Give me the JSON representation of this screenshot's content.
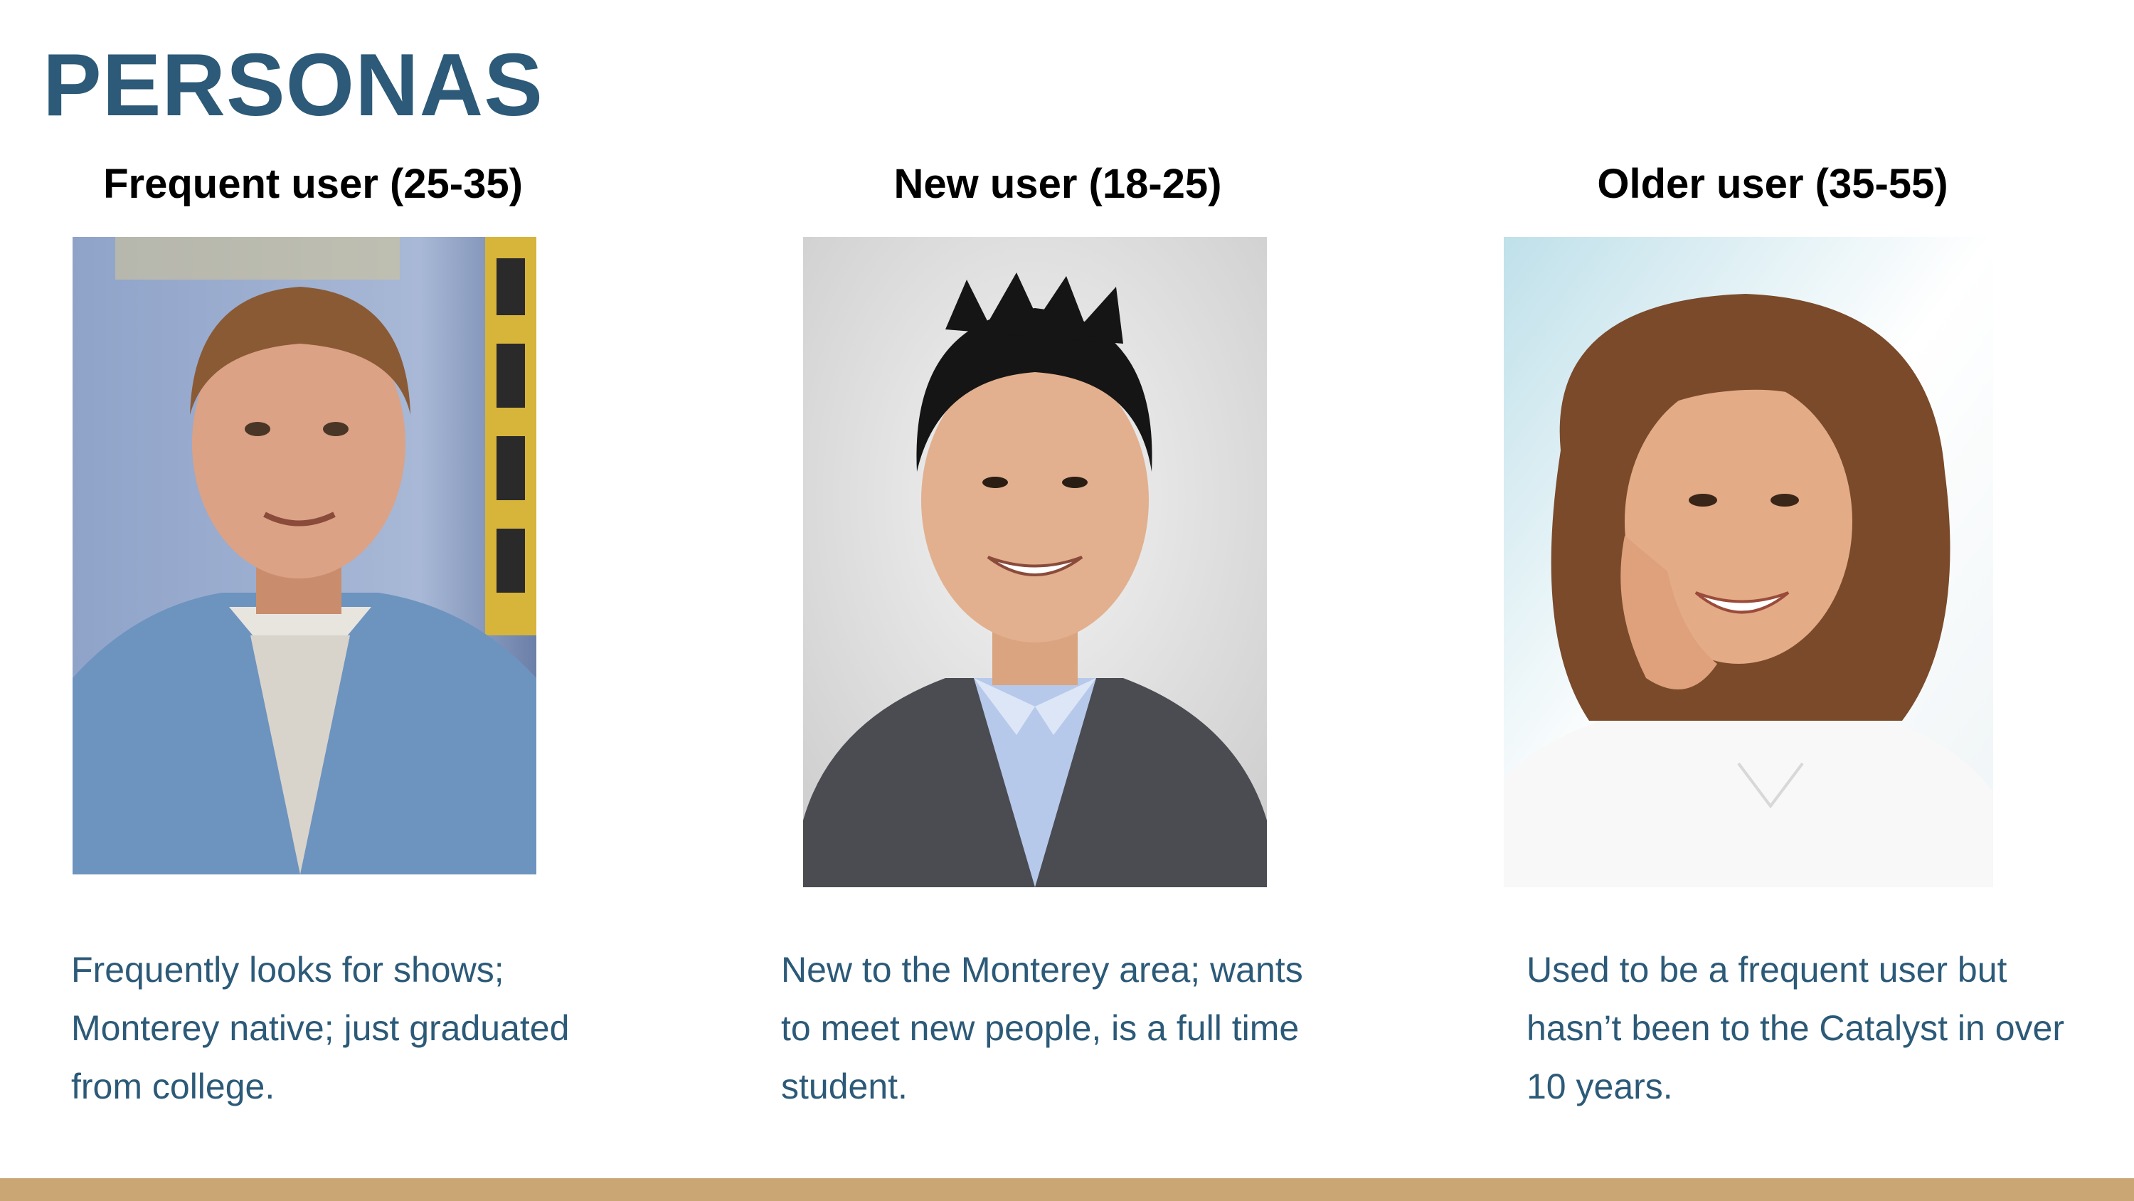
{
  "slide": {
    "title": "PERSONAS"
  },
  "personas": [
    {
      "heading": "Frequent user (25-35)",
      "description": "Frequently looks for shows; Monterey native; just graduated from college.",
      "photo_alt": "photo of a man in a denim jacket"
    },
    {
      "heading": "New user (18-25)",
      "description": "New to the Monterey area; wants to meet new people, is a full time student.",
      "photo_alt": "photo of a young man in a suit"
    },
    {
      "heading": "Older user (35-55)",
      "description": "Used to be a frequent user but hasn’t been to the Catalyst in over 10 years.",
      "photo_alt": "photo of a smiling woman"
    }
  ],
  "colors": {
    "title": "#2c5a78",
    "description": "#2c5a78",
    "footer_bar": "#c9a673"
  }
}
